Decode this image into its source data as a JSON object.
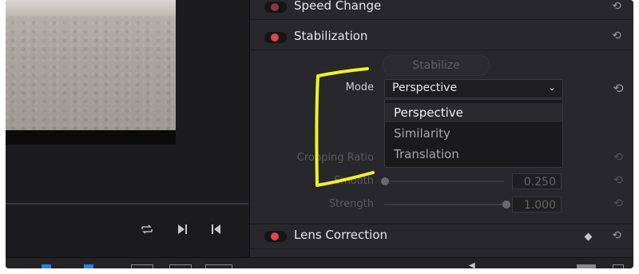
{
  "inspector": {
    "speed_change": {
      "title": "Speed Change"
    },
    "stabilization": {
      "title": "Stabilization",
      "stabilize_button": "Stabilize",
      "mode_label": "Mode",
      "mode_value": "Perspective",
      "mode_options": [
        "Perspective",
        "Similarity",
        "Translation"
      ],
      "cropping_ratio_label": "Cropping Ratio",
      "smooth_label": "Smooth",
      "smooth_value": "0.250",
      "strength_label": "Strength",
      "strength_value": "1.000"
    },
    "lens_correction": {
      "title": "Lens Correction"
    }
  },
  "colors": {
    "panel_bg": "#28282c",
    "toggle_on": "#e0454a",
    "annotation": "#f1f12a"
  },
  "icons": {
    "reset": "reset-icon",
    "loop": "loop-icon",
    "next_frame": "next-frame-icon",
    "prev_frame": "prev-frame-icon",
    "chevron": "chevron-down-icon"
  }
}
